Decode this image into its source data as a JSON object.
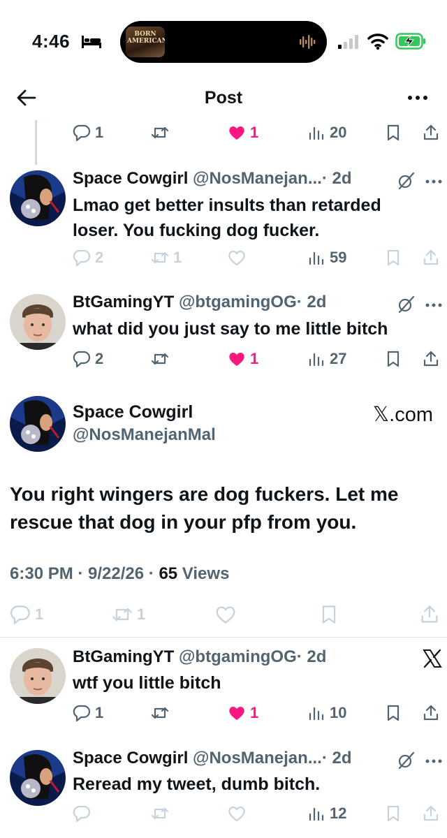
{
  "status_bar": {
    "time": "4:46",
    "now_playing_art_text": "BORN AMERICAN"
  },
  "nav": {
    "title": "Post"
  },
  "replies": [
    {
      "id": "r0",
      "actions": {
        "reply": "1",
        "retweet": "",
        "like": "1",
        "views": "20"
      },
      "liked": true
    },
    {
      "id": "r1",
      "name": "Space Cowgirl",
      "handle": "@NosManejan...",
      "time": "· 2d",
      "text": "Lmao get better insults than retarded loser. You fucking dog fucker.",
      "actions": {
        "reply": "2",
        "retweet": "1",
        "like": "",
        "views": "59"
      }
    },
    {
      "id": "r2",
      "name": "BtGamingYT",
      "handle": "@btgamingOG",
      "time": "· 2d",
      "text": "what did you just say to me little bitch",
      "actions": {
        "reply": "2",
        "retweet": "",
        "like": "1",
        "views": "27"
      },
      "liked": true
    }
  ],
  "main_post": {
    "name": "Space Cowgirl",
    "handle": "@NosManejanMal",
    "watermark": "𝕏.com",
    "text": "You right wingers are dog fuckers. Let me rescue that dog in your pfp from you.",
    "timestamp": "6:30 PM · 9/22/26 · ",
    "views_count": "65",
    "views_label": " Views",
    "actions": {
      "reply": "1",
      "retweet": "1",
      "like": ""
    }
  },
  "after": [
    {
      "name": "BtGamingYT",
      "handle": "@btgamingOG",
      "time": "· 2d",
      "text": "wtf you little bitch",
      "actions": {
        "reply": "1",
        "retweet": "",
        "like": "1",
        "views": "10"
      },
      "liked": true
    },
    {
      "name": "Space Cowgirl",
      "handle": "@NosManejan...",
      "time": "· 2d",
      "text": "Reread my tweet, dumb bitch.",
      "actions": {
        "reply": "",
        "retweet": "",
        "like": "",
        "views": "12"
      }
    }
  ],
  "colors": {
    "text": "#0f1419",
    "secondary": "#536471",
    "faded": "#c6d3dd",
    "like_pink": "#f91880",
    "battery_green": "#34c759"
  },
  "icons": [
    "back-arrow-icon",
    "more-icon",
    "reply-icon",
    "retweet-icon",
    "heart-icon",
    "views-icon",
    "bookmark-icon",
    "share-icon",
    "grok-icon",
    "x-logo-icon"
  ]
}
